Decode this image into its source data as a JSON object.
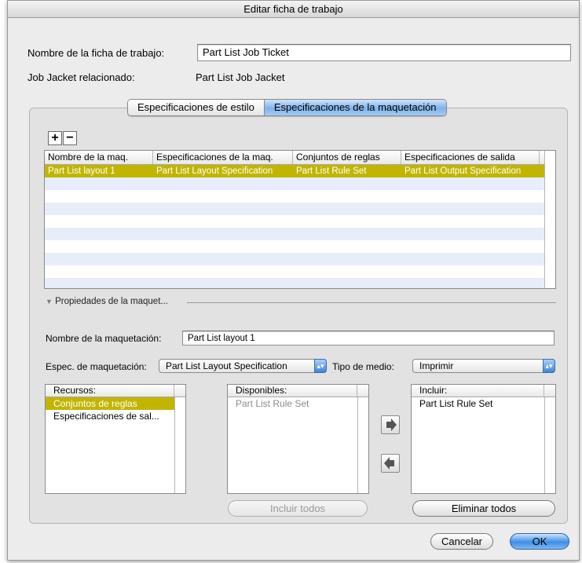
{
  "window": {
    "title": "Editar ficha de trabajo"
  },
  "ticket": {
    "name_label": "Nombre de la ficha de trabajo:",
    "name_value": "Part List Job Ticket",
    "jacket_label": "Job Jacket relacionado:",
    "jacket_value": "Part List Job Jacket"
  },
  "tabs": [
    {
      "label": "Especificaciones de estilo",
      "active": false
    },
    {
      "label": "Especificaciones de la maquetación",
      "active": true
    }
  ],
  "toolbar": {
    "add_label": "+",
    "remove_label": "−"
  },
  "layouts_table": {
    "columns": [
      "Nombre de la maq.",
      "Especificaciones de la maq.",
      "Conjuntos de reglas",
      "Especificaciones de salida"
    ],
    "rows": [
      [
        "Part List layout 1",
        "Part List Layout Specification",
        "Part List Rule Set",
        "Part List Output Specification"
      ]
    ],
    "selected_row": 0
  },
  "properties": {
    "disclosure_label": "Propiedades de la maquet...",
    "layout_name_label": "Nombre de la maquetación:",
    "layout_name_value": "Part List layout 1",
    "layout_spec_label": "Espec. de maquetación:",
    "layout_spec_value": "Part List Layout Specification",
    "media_type_label": "Tipo de medio:",
    "media_type_value": "Imprimir"
  },
  "resources": {
    "header": "Recursos:",
    "items": [
      "Conjuntos de reglas",
      "Especificaciones de sal..."
    ],
    "selected": 0
  },
  "available": {
    "header": "Disponibles:",
    "items": [
      "Part List Rule Set"
    ]
  },
  "include": {
    "header": "Incluir:",
    "items": [
      "Part List Rule Set"
    ]
  },
  "buttons": {
    "include_all": "Incluir todos",
    "remove_all": "Eliminar todos",
    "cancel": "Cancelar",
    "ok": "OK"
  },
  "icons": {
    "move_right": "right-arrow-icon",
    "move_left": "left-arrow-icon"
  },
  "colors": {
    "selection": "#c2b500",
    "accent_blue": "#3f8ee4",
    "stripe": "#e7eefa"
  }
}
